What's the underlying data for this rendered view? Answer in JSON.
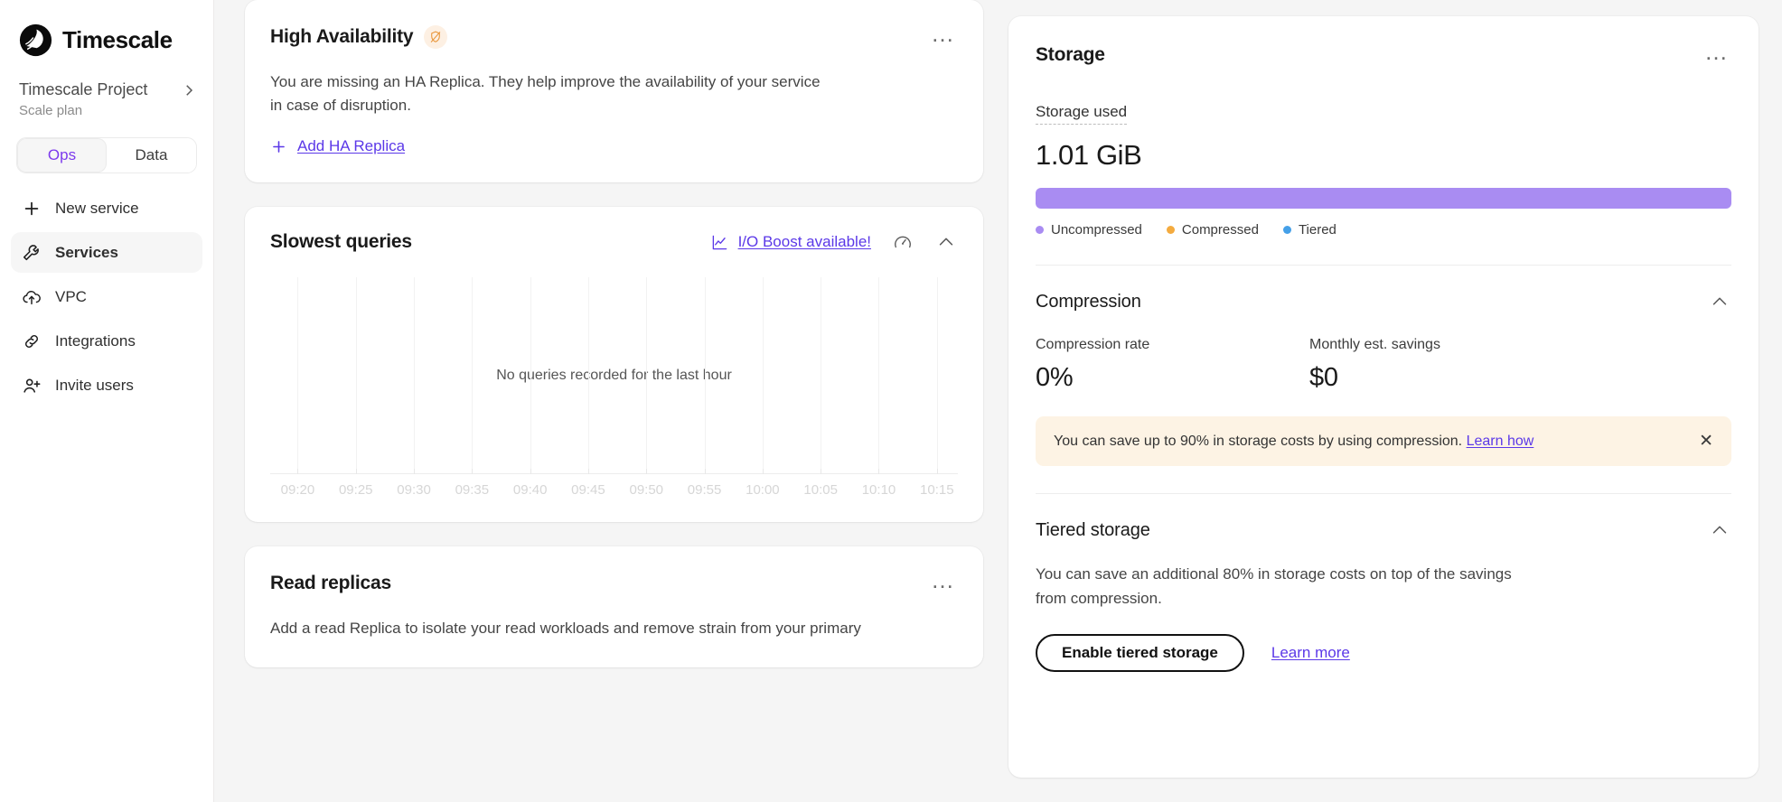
{
  "sidebar": {
    "brand": "Timescale",
    "brand_logo_icon": "timescale-logo-icon",
    "project": {
      "name": "Timescale Project",
      "plan": "Scale plan",
      "chevron_icon": "chevron-right-icon"
    },
    "tabs": [
      {
        "label": "Ops",
        "active": true
      },
      {
        "label": "Data",
        "active": false
      }
    ],
    "items": [
      {
        "label": "New service",
        "icon": "plus-icon",
        "active": false
      },
      {
        "label": "Services",
        "icon": "wrench-icon",
        "active": true
      },
      {
        "label": "VPC",
        "icon": "cloud-upload-icon",
        "active": false
      },
      {
        "label": "Integrations",
        "icon": "link-chain-icon",
        "active": false
      },
      {
        "label": "Invite users",
        "icon": "user-plus-icon",
        "active": false
      }
    ]
  },
  "high_availability": {
    "title": "High Availability",
    "status_icon": "shield-off-icon",
    "menu_icon": "kebab-menu-icon",
    "menu_glyph": "…",
    "description": "You are missing an HA Replica. They help improve the availability of your service in case of disruption.",
    "add_link": "Add HA Replica",
    "add_icon": "plus-icon"
  },
  "slowest_queries": {
    "title": "Slowest queries",
    "io_boost_link": "I/O Boost available!",
    "io_boost_icon": "chart-line-icon",
    "gauge_icon": "gauge-icon",
    "collapse_icon": "chevron-up-icon",
    "empty_message": "No queries recorded for the last hour"
  },
  "read_replicas": {
    "title": "Read replicas",
    "menu_glyph": "…",
    "description": "Add a read Replica to isolate your read workloads and remove strain from your primary"
  },
  "storage": {
    "title": "Storage",
    "menu_glyph": "…",
    "used_label": "Storage used",
    "used_value": "1.01 GiB",
    "legend": [
      {
        "label": "Uncompressed",
        "color": "#a98cf2"
      },
      {
        "label": "Compressed",
        "color": "#f4ab3f"
      },
      {
        "label": "Tiered",
        "color": "#45a0e8"
      }
    ],
    "compression": {
      "title": "Compression",
      "collapse_icon": "chevron-up-icon",
      "rate_label": "Compression rate",
      "rate_value": "0%",
      "savings_label": "Monthly est. savings",
      "savings_value": "$0",
      "notice_text": "You can save up to 90% in storage costs by using compression.",
      "notice_link": "Learn how",
      "notice_close_glyph": "✕"
    },
    "tiered": {
      "title": "Tiered storage",
      "collapse_icon": "chevron-up-icon",
      "description": "You can save an additional 80% in storage costs on top of the savings from compression.",
      "enable_button": "Enable tiered storage",
      "learn_more_link": "Learn more"
    }
  },
  "chart_data": {
    "type": "line",
    "title": "Slowest queries",
    "xlabel": "",
    "ylabel": "",
    "grid": true,
    "legend_position": "none",
    "x": [
      "09:20",
      "09:25",
      "09:30",
      "09:35",
      "09:40",
      "09:45",
      "09:50",
      "09:55",
      "10:00",
      "10:05",
      "10:10",
      "10:15"
    ],
    "series": [],
    "values": [],
    "annotation": "No queries recorded for the last hour"
  },
  "storage_chart": {
    "type": "bar",
    "orientation": "horizontal-stacked",
    "categories": [
      "Uncompressed",
      "Compressed",
      "Tiered"
    ],
    "values": [
      100,
      0,
      0
    ],
    "unit": "percent",
    "total_label": "1.01 GiB"
  }
}
